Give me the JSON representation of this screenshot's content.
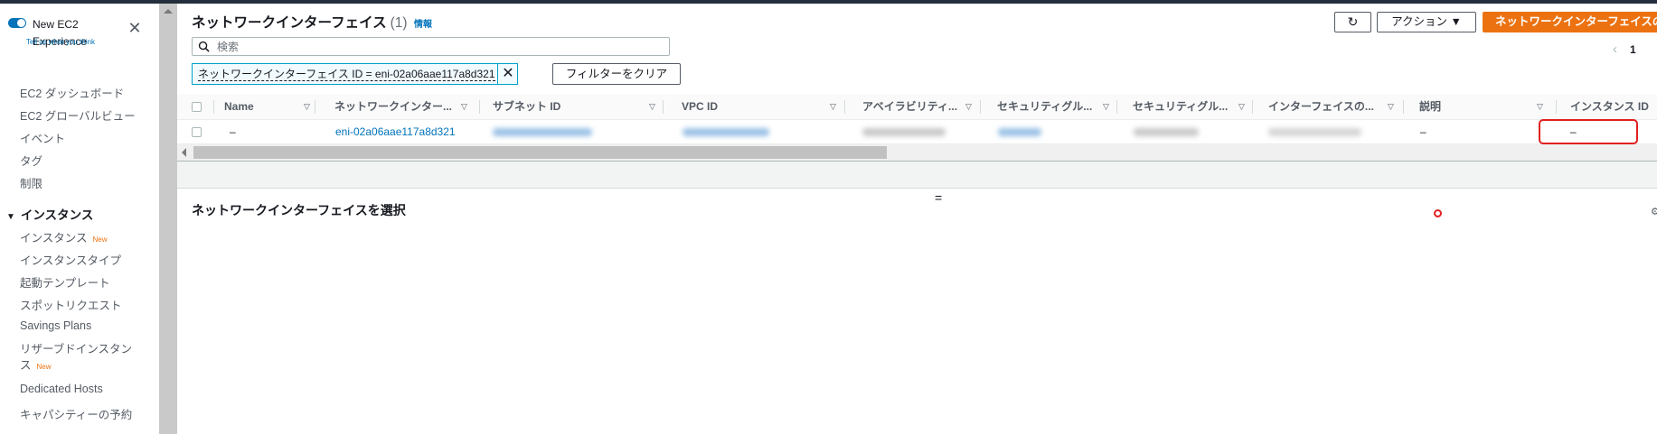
{
  "sidebar": {
    "toggle_label": "New EC2 Experience",
    "tell_us": "Tell us what you think",
    "items": [
      {
        "label": "EC2 ダッシュボード"
      },
      {
        "label": "EC2 グローバルビュー"
      },
      {
        "label": "イベント"
      },
      {
        "label": "タグ"
      },
      {
        "label": "制限"
      }
    ],
    "section": "インスタンス",
    "section_items": [
      {
        "label": "インスタンス",
        "badge": "New"
      },
      {
        "label": "インスタンスタイプ"
      },
      {
        "label": "起動テンプレート"
      },
      {
        "label": "スポットリクエスト"
      },
      {
        "label": "Savings Plans"
      },
      {
        "label": "リザーブドインスタンス",
        "badge": "New"
      },
      {
        "label": "Dedicated Hosts"
      },
      {
        "label": "キャパシティーの予約"
      }
    ]
  },
  "header": {
    "title": "ネットワークインターフェイス",
    "count": "(1)",
    "info": "情報",
    "refresh_icon": "↻",
    "action_label": "アクション ▼",
    "create_label": "ネットワークインターフェイスの作成"
  },
  "pager": {
    "prev": "‹",
    "page": "1"
  },
  "search": {
    "placeholder": "検索"
  },
  "filter": {
    "token": "ネットワークインターフェイス ID = eni-02a06aae117a8d321",
    "clear_label": "フィルターをクリア"
  },
  "table": {
    "columns": [
      {
        "label": "Name"
      },
      {
        "label": "ネットワークインター..."
      },
      {
        "label": "サブネット ID"
      },
      {
        "label": "VPC ID"
      },
      {
        "label": "アベイラビリティ..."
      },
      {
        "label": "セキュリティグル..."
      },
      {
        "label": "セキュリティグル..."
      },
      {
        "label": "インターフェイスの..."
      },
      {
        "label": "説明"
      },
      {
        "label": "インスタンス ID"
      }
    ],
    "rows": [
      {
        "name": "–",
        "eni": "eni-02a06aae117a8d321",
        "description": "–",
        "instance_id": "–"
      }
    ]
  },
  "panel": {
    "handle": "=",
    "title": "ネットワークインターフェイスを選択"
  },
  "colors": {
    "accent": "#0073bb",
    "create_button": "#ec7211",
    "highlight": "#e02020"
  }
}
